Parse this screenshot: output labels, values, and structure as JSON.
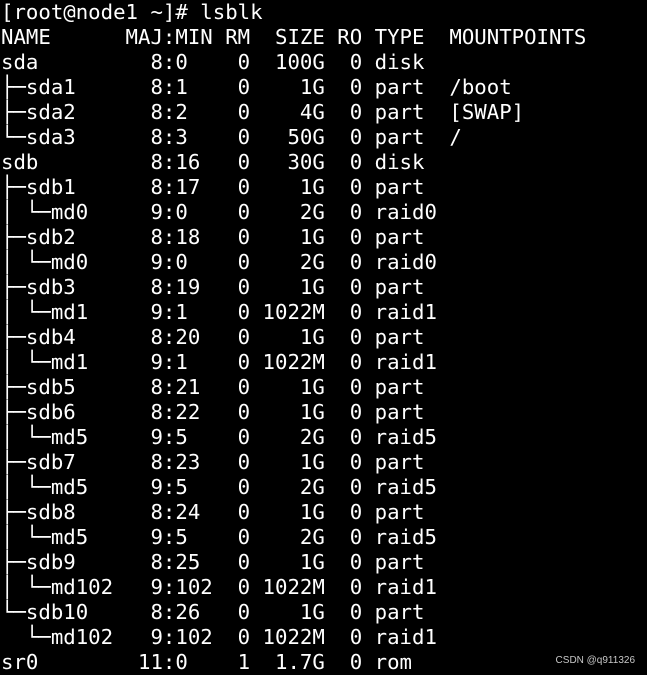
{
  "terminal": {
    "prompt": "[root@node1 ~]# lsblk",
    "header": "NAME      MAJ:MIN RM  SIZE RO TYPE  MOUNTPOINTS",
    "rows": [
      "sda         8:0    0  100G  0 disk",
      "├─sda1      8:1    0    1G  0 part  /boot",
      "├─sda2      8:2    0    4G  0 part  [SWAP]",
      "└─sda3      8:3    0   50G  0 part  /",
      "sdb         8:16   0   30G  0 disk",
      "├─sdb1      8:17   0    1G  0 part",
      "│ └─md0     9:0    0    2G  0 raid0",
      "├─sdb2      8:18   0    1G  0 part",
      "│ └─md0     9:0    0    2G  0 raid0",
      "├─sdb3      8:19   0    1G  0 part",
      "│ └─md1     9:1    0 1022M  0 raid1",
      "├─sdb4      8:20   0    1G  0 part",
      "│ └─md1     9:1    0 1022M  0 raid1",
      "├─sdb5      8:21   0    1G  0 part",
      "├─sdb6      8:22   0    1G  0 part",
      "│ └─md5     9:5    0    2G  0 raid5",
      "├─sdb7      8:23   0    1G  0 part",
      "│ └─md5     9:5    0    2G  0 raid5",
      "├─sdb8      8:24   0    1G  0 part",
      "│ └─md5     9:5    0    2G  0 raid5",
      "├─sdb9      8:25   0    1G  0 part",
      "│ └─md102   9:102  0 1022M  0 raid1",
      "└─sdb10     8:26   0    1G  0 part",
      "  └─md102   9:102  0 1022M  0 raid1",
      "sr0        11:0    1  1.7G  0 rom"
    ]
  },
  "watermark": "CSDN @q911326",
  "colors": {
    "background": "#000000",
    "text": "#ffffff"
  }
}
